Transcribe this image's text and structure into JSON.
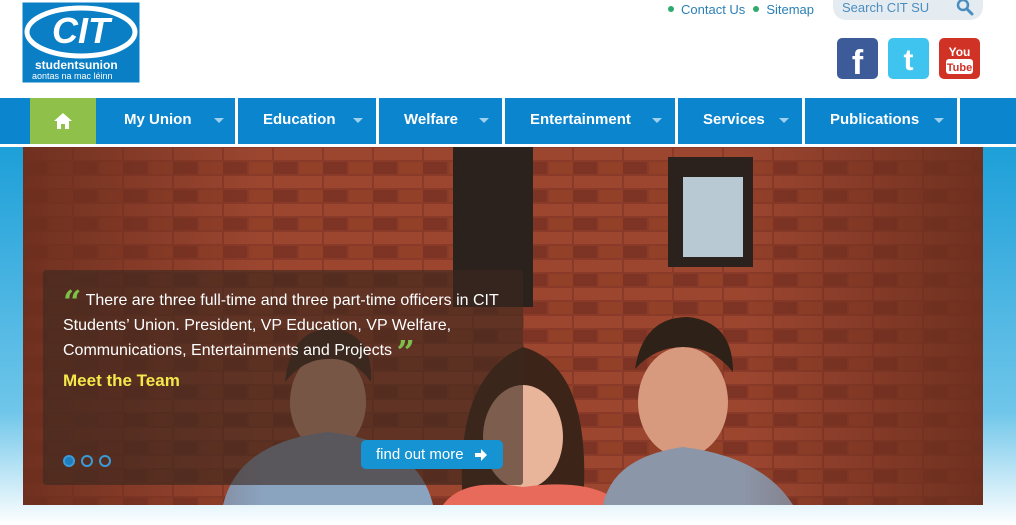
{
  "logo": {
    "line1": "CIT",
    "line2": "studentsunion",
    "line3": "aontas na mac léinn"
  },
  "toplinks": {
    "contact": "Contact Us",
    "sitemap": "Sitemap"
  },
  "search": {
    "placeholder": "Search CIT SU"
  },
  "social": [
    {
      "name": "facebook-icon",
      "label": "f"
    },
    {
      "name": "twitter-icon",
      "label": "t"
    },
    {
      "name": "youtube-icon",
      "label1": "You",
      "label2": "Tube"
    }
  ],
  "nav": {
    "items": [
      {
        "label": "My Union"
      },
      {
        "label": "Education"
      },
      {
        "label": "Welfare"
      },
      {
        "label": "Entertainment"
      },
      {
        "label": "Services"
      },
      {
        "label": "Publications"
      }
    ]
  },
  "hero": {
    "quote": "There are three full-time and three part-time officers in CIT Students’ Union. President, VP Education, VP Welfare, Communications, Entertainments and Projects",
    "link": "Meet the Team",
    "button": "find out more"
  },
  "colors": {
    "nav": "#0a85ce",
    "home": "#8fc14a",
    "accent_green": "#7dc04a",
    "meet_yellow": "#f4e94a"
  }
}
